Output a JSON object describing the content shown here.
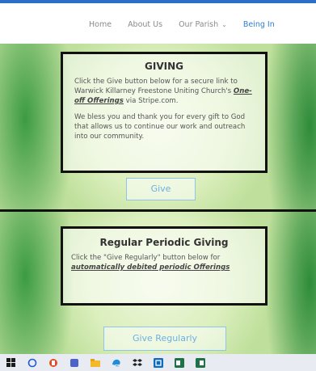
{
  "nav": {
    "items": [
      "Home",
      "About Us",
      "Our Parish",
      "Being In"
    ],
    "parish_caret": "⌄"
  },
  "giving": {
    "title": "GIVING",
    "para1_start": "Click the Give button below for a secure link to Warwick Killarney Freestone Uniting Church's ",
    "para1_link": "One-off Offerings",
    "para1_end": " via Stripe.com.",
    "para2": "We bless you and thank you for every gift to God that allows us to continue our work and outreach into our community.",
    "button": "Give"
  },
  "regular": {
    "title": "Regular Periodic Giving",
    "para_start": "Click the \"Give Regularly\" button below for ",
    "para_link": "automatically debited periodic Offerings",
    "button": "Give Regularly"
  },
  "taskbar": {
    "icons": [
      "windows-icon",
      "search-icon",
      "office-icon",
      "teams-icon",
      "file-explorer-icon",
      "edge-icon",
      "dropbox-icon",
      "outlook-icon",
      "excel-icon",
      "word-icon"
    ]
  }
}
